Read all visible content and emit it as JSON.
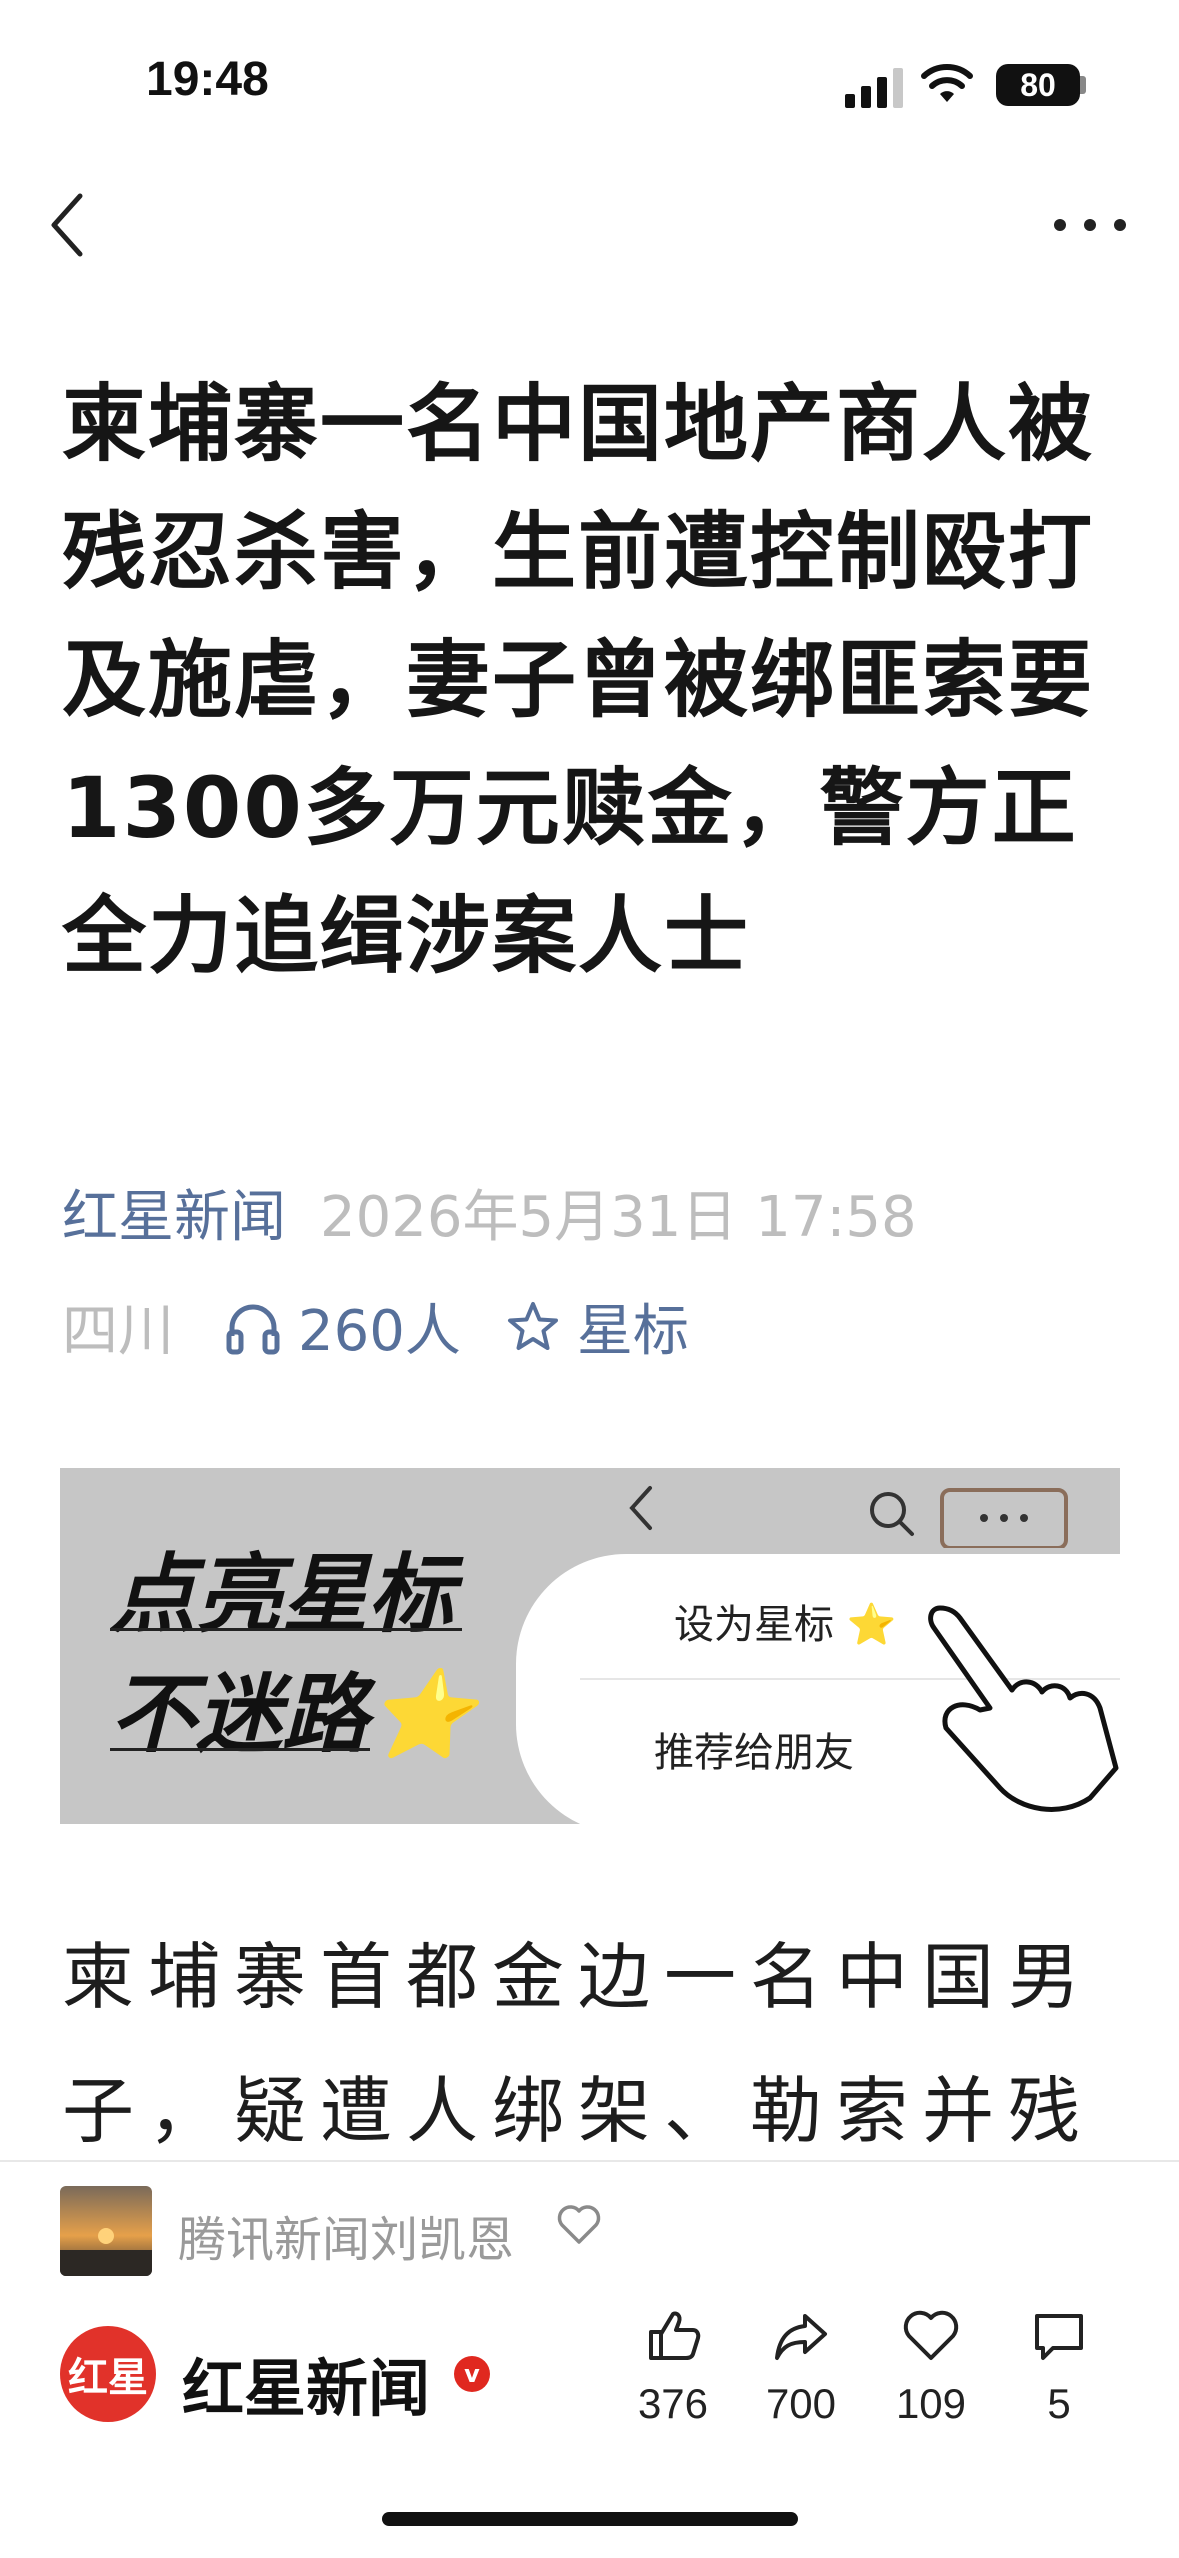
{
  "status_bar": {
    "time": "19:48",
    "battery": "80"
  },
  "article": {
    "title": "柬埔寨一名中国地产商人被残忍杀害，生前遭控制殴打及施虐，妻子曾被绑匪索要1300多万元赎金，警方正全力追缉涉案人士",
    "source": "红星新闻",
    "datetime": "2026年5月31日 17:58",
    "region": "四川",
    "listen_count": "260人",
    "star_label": "星标",
    "body": "柬埔寨首都金边一名中国男子，疑遭人绑架、勒索并残忍"
  },
  "banner": {
    "line1": "点亮星标",
    "line2": "不迷路⭐",
    "menu_item1": "设为星标 ⭐",
    "menu_item2": "推荐给朋友"
  },
  "bottom_bar": {
    "author": "腾讯新闻刘凯恩",
    "logo_text": "红星",
    "brand": "红星新闻",
    "verified_mark": "v",
    "actions": [
      {
        "name": "like",
        "count": "376"
      },
      {
        "name": "share",
        "count": "700"
      },
      {
        "name": "favorite",
        "count": "109"
      },
      {
        "name": "comment",
        "count": "5"
      }
    ]
  },
  "colors": {
    "accent": "#57709a",
    "muted": "#bdbdbd",
    "brand_red": "#e1322a"
  }
}
